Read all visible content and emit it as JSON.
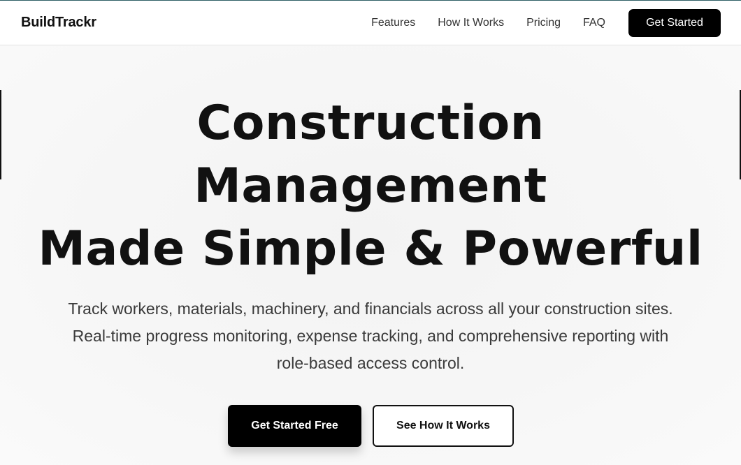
{
  "brand": {
    "name": "BuildTrackr"
  },
  "nav": {
    "links": [
      "Features",
      "How It Works",
      "Pricing",
      "FAQ"
    ],
    "cta_label": "Get Started"
  },
  "hero": {
    "headline_lines": [
      "Construction",
      "Management",
      "Made Simple & Powerful"
    ],
    "subtext": "Track workers, materials, machinery, and financials across all your construction sites. Real-time progress monitoring, expense tracking, and comprehensive reporting with role-based access control.",
    "primary_button_label": "Get Started Free",
    "secondary_button_label": "See How It Works"
  },
  "colors": {
    "accent": "#000000",
    "background": "#f7f7f7",
    "text": "#111111",
    "muted_text": "#3a3a3a",
    "top_accent_line": "#2f5f66"
  }
}
